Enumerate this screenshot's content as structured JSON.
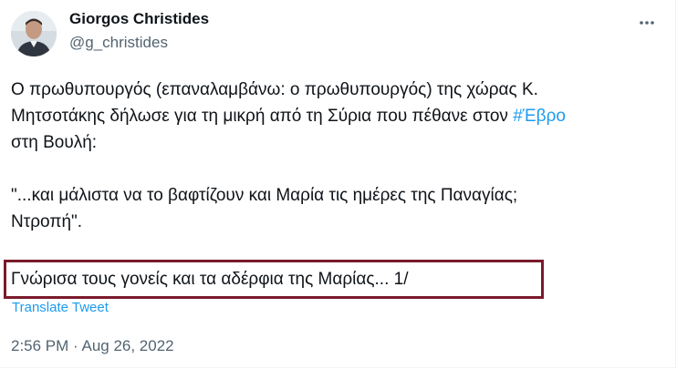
{
  "author": {
    "name": "Giorgos Christides",
    "handle": "@g_christides",
    "avatar_icon": "user-photo"
  },
  "more_icon": "more-horizontal-icon",
  "tweet": {
    "line1": "Ο πρωθυπουργός (επαναλαμβάνω: ο πρωθυπουργός) της χώρας Κ.",
    "line2_text": "Μητσοτάκης δήλωσε για τη μικρή από τη Σύρια που πέθανε στον ",
    "hashtag": "#Έβρο",
    "line3": "στη Βουλή:",
    "quote_line1": "\"...και μάλιστα να το βαφτίζουν και Μαρία τις ημέρες της Παναγίας;",
    "quote_line2": "Ντροπή\".",
    "highlighted_line": "Γνώρισα τους γονείς και τα αδέρφια της Μαρίας... 1/"
  },
  "translate_label": "Translate Tweet",
  "timestamp": "2:56 PM · Aug 26, 2022",
  "colors": {
    "link": "#1d9bf0",
    "highlight_border": "#7a1a2c",
    "secondary_text": "#536471"
  }
}
